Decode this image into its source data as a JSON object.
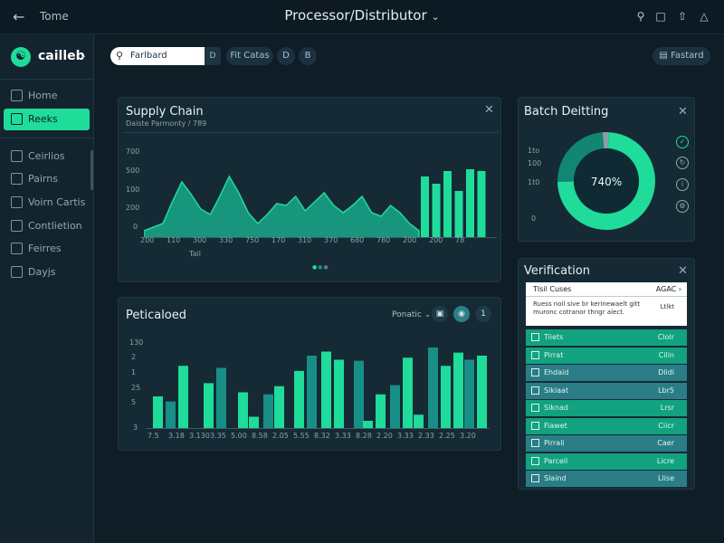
{
  "topbar": {
    "crumb": "Tome",
    "title": "Processor/Distributor",
    "icons": [
      "search-icon",
      "square-icon",
      "share-icon",
      "bell-icon"
    ]
  },
  "brand": {
    "name": "cailleb"
  },
  "sidebar": {
    "items": [
      {
        "label": "Home",
        "icon": "home-icon"
      },
      {
        "label": "Reeks",
        "icon": "grid-icon",
        "active": true
      },
      {
        "label": "Ceirlios",
        "icon": "box-icon"
      },
      {
        "label": "Pairns",
        "icon": "pair-icon"
      },
      {
        "label": "Voirn Cartis",
        "icon": "card-icon"
      },
      {
        "label": "Contlietion",
        "icon": "doc-icon"
      },
      {
        "label": "Feirres",
        "icon": "file-icon"
      },
      {
        "label": "Dayjs",
        "icon": "gear-icon"
      }
    ]
  },
  "toolbar": {
    "search_value": "Farlbard",
    "search_btn": "D",
    "chips": [
      "Fit Catas",
      "D",
      "B"
    ],
    "right_button": "Fastard"
  },
  "supply_chain": {
    "title": "Supply Chain",
    "subtitle": "Daiste Parmonty / 789",
    "xlabel": "Tail",
    "pager": [
      "●",
      "●",
      "●"
    ]
  },
  "batch": {
    "title": "Batch Deitting",
    "center_label": "740%",
    "axis": [
      "1to",
      "100",
      "1t0",
      "0"
    ],
    "icons": [
      "check-circle-icon",
      "refresh-icon",
      "info-icon",
      "settings-icon"
    ]
  },
  "periodical": {
    "title": "Peticaloed",
    "filter_label": "Ponatic",
    "controls": [
      "▣",
      "◉",
      "1"
    ]
  },
  "verification": {
    "title": "Verification",
    "head_label": "TIsil Cuses",
    "head_value": "AGAC",
    "note": "Ruess noil sive br kerinewaelt gitt muronc cotranor thngr aiect.",
    "note_value": "Ltlkt",
    "rows": [
      {
        "label": "Tiiets",
        "value": "Clolr",
        "color": "#12a27f"
      },
      {
        "label": "Pirrat",
        "value": "Cilin",
        "color": "#12a27f"
      },
      {
        "label": "Ehdaid",
        "value": "Dlidi",
        "color": "#2a7d86"
      },
      {
        "label": "Sikiaat",
        "value": "Lbr5",
        "color": "#2a7d86"
      },
      {
        "label": "Siknad",
        "value": "Lrsr",
        "color": "#12a27f"
      },
      {
        "label": "Fiawet",
        "value": "Ciicr",
        "color": "#12a27f"
      },
      {
        "label": "Pirrali",
        "value": "Caer",
        "color": "#2a7d86"
      },
      {
        "label": "Parceil",
        "value": "Licre",
        "color": "#12a27f"
      },
      {
        "label": "Slaind",
        "value": "Llise",
        "color": "#2a7d86"
      }
    ]
  },
  "chart_data": [
    {
      "type": "area",
      "title": "Supply Chain",
      "subtitle": "Daiste Parmonty / 789",
      "xlabel": "Tail",
      "ylabel": "",
      "y_ticks": [
        "700",
        "500",
        "100",
        "200",
        "0"
      ],
      "x_ticks": [
        "200",
        "110",
        "300",
        "330",
        "750",
        "170",
        "310",
        "370",
        "680",
        "780",
        "200",
        "200",
        "78"
      ],
      "ylim": [
        0,
        500
      ],
      "area_series": {
        "name": "",
        "values": [
          40,
          60,
          80,
          200,
          310,
          240,
          160,
          130,
          230,
          340,
          250,
          140,
          80,
          130,
          190,
          180,
          230,
          150,
          200,
          250,
          180,
          140,
          180,
          230,
          140,
          120,
          180,
          140,
          80,
          40
        ]
      },
      "bar_series": {
        "name": "",
        "values": [
          340,
          300,
          370,
          260,
          380,
          370
        ]
      },
      "colors": [
        "#1fdc9a",
        "#18a98a"
      ]
    },
    {
      "type": "pie",
      "title": "Batch Deitting",
      "slices": [
        {
          "value": 74,
          "color": "#1fdc9a"
        },
        {
          "value": 24,
          "color": "#138673"
        },
        {
          "value": 2,
          "color": "#8a9fa5"
        }
      ]
    },
    {
      "type": "bar",
      "title": "Peticaloed",
      "y_ticks": [
        "130",
        "2",
        "1",
        "25",
        "5",
        "3"
      ],
      "x_ticks": [
        "7.5",
        "3.18",
        "3.130",
        "3.35",
        "5.00",
        "8.58",
        "2.05",
        "5.55",
        "8.32",
        "3.33",
        "8.28",
        "2.20",
        "3.33",
        "2.33",
        "2.25",
        "3.20"
      ],
      "ylim": [
        0,
        80
      ],
      "series": [
        {
          "name": "",
          "values": [
            32,
            27,
            62,
            45,
            60,
            36,
            12,
            34,
            42,
            57,
            72,
            76,
            68,
            67,
            8,
            34,
            43,
            70,
            14,
            80,
            62,
            75,
            68,
            72
          ]
        }
      ],
      "colors": [
        "#1fdc9a",
        "#178f86"
      ]
    }
  ]
}
